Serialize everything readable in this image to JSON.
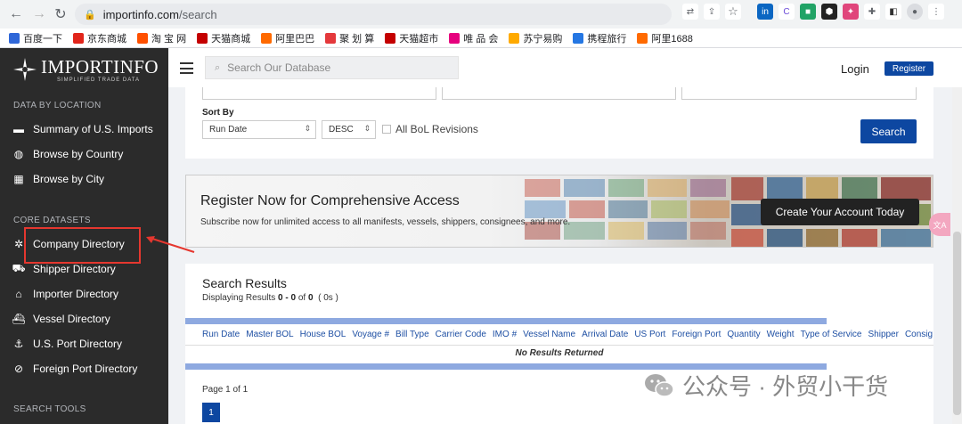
{
  "browser": {
    "url_domain": "importinfo.com",
    "url_path": "/search",
    "bookmarks": [
      {
        "label": "百度一下",
        "color": "#2f67d8"
      },
      {
        "label": "京东商城",
        "color": "#e1251b"
      },
      {
        "label": "淘 宝 网",
        "color": "#ff5000"
      },
      {
        "label": "天猫商城",
        "color": "#c40000"
      },
      {
        "label": "阿里巴巴",
        "color": "#ff6a00"
      },
      {
        "label": "聚 划 算",
        "color": "#e4393c"
      },
      {
        "label": "天猫超市",
        "color": "#c40000"
      },
      {
        "label": "唯 品 会",
        "color": "#e6007e"
      },
      {
        "label": "苏宁易购",
        "color": "#ffaa00"
      },
      {
        "label": "携程旅行",
        "color": "#2577e3"
      },
      {
        "label": "阿里1688",
        "color": "#ff6a00"
      }
    ]
  },
  "logo": {
    "name": "IMPORTINFO",
    "tagline": "SIMPLIFIED TRADE DATA"
  },
  "sidebar": {
    "section1": "DATA BY LOCATION",
    "location_items": [
      {
        "label": "Summary of U.S. Imports",
        "icon": "flag-icon"
      },
      {
        "label": "Browse by Country",
        "icon": "globe-icon"
      },
      {
        "label": "Browse by City",
        "icon": "building-icon"
      }
    ],
    "section2": "CORE DATASETS",
    "core_items": [
      {
        "label": "Company Directory",
        "icon": "users-icon"
      },
      {
        "label": "Shipper Directory",
        "icon": "truck-icon"
      },
      {
        "label": "Importer Directory",
        "icon": "warehouse-icon"
      },
      {
        "label": "Vessel Directory",
        "icon": "ship-icon"
      },
      {
        "label": "U.S. Port Directory",
        "icon": "anchor-icon"
      },
      {
        "label": "Foreign Port Directory",
        "icon": "compass-icon"
      }
    ],
    "section3": "SEARCH TOOLS"
  },
  "header": {
    "search_placeholder": "Search Our Database",
    "login": "Login",
    "register": "Register"
  },
  "sort": {
    "label": "Sort By",
    "field": "Run Date",
    "order": "DESC",
    "checkbox_label": "All BoL Revisions",
    "search_button": "Search"
  },
  "banner": {
    "title": "Register Now for Comprehensive Access",
    "subtitle": "Subscribe now for unlimited access to all manifests, vessels, shippers, consignees, and more.",
    "cta": "Create Your Account Today"
  },
  "side_badge": "文A",
  "results": {
    "title": "Search Results",
    "displaying_prefix": "Displaying Results",
    "range": "0 - 0",
    "of_text": "of",
    "total": "0",
    "time": "( 0s )",
    "columns": [
      "Run Date",
      "Master BOL",
      "House BOL",
      "Voyage #",
      "Bill Type",
      "Carrier Code",
      "IMO #",
      "Vessel Name",
      "Arrival Date",
      "US Port",
      "Foreign Port",
      "Quantity",
      "Weight",
      "Type of Service",
      "Shipper",
      "Consig"
    ],
    "no_results": "No Results Returned",
    "page_info": "Page 1 of 1",
    "current_page": "1"
  },
  "watermark": "公众号 · 外贸小干货"
}
